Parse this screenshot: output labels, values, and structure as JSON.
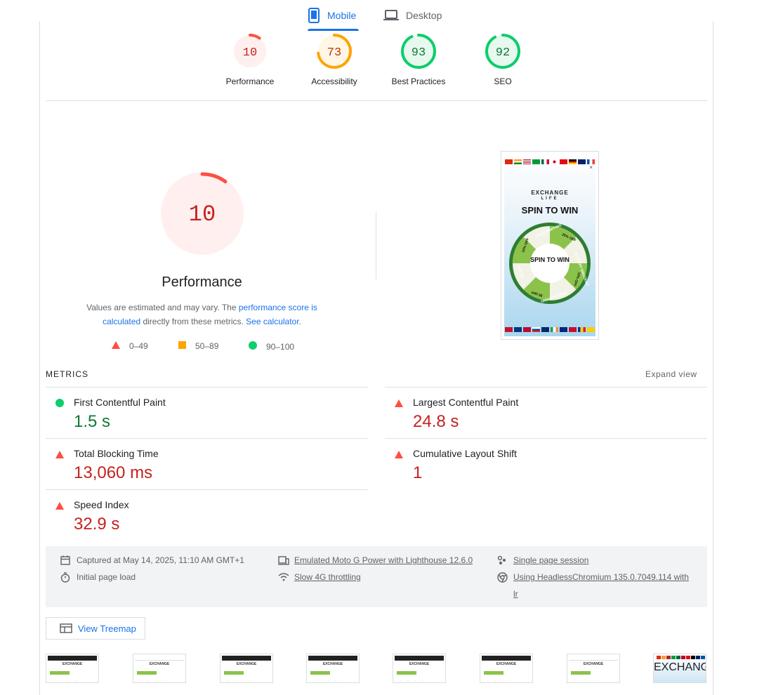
{
  "tabs": {
    "mobile": "Mobile",
    "desktop": "Desktop",
    "active": "mobile"
  },
  "categories": [
    {
      "score": "10",
      "label": "Performance",
      "value": 10,
      "rating": "fail"
    },
    {
      "score": "73",
      "label": "Accessibility",
      "value": 73,
      "rating": "average"
    },
    {
      "score": "93",
      "label": "Best Practices",
      "value": 93,
      "rating": "pass"
    },
    {
      "score": "92",
      "label": "SEO",
      "value": 92,
      "rating": "pass"
    }
  ],
  "performance": {
    "score": "10",
    "value": 10,
    "title": "Performance",
    "desc_prefix": "Values are estimated and may vary. The ",
    "desc_link1": "performance score is calculated",
    "desc_middle": " directly from these metrics. ",
    "desc_link2": "See calculator",
    "desc_suffix": "."
  },
  "legend": {
    "fail": "0–49",
    "average": "50–89",
    "pass": "90–100"
  },
  "screenshot": {
    "brand_line1": "EXCHANGE",
    "brand_line2": "LIFE",
    "headline": "SPIN TO WIN",
    "wheel_center": "SPIN TO WIN",
    "close": "×",
    "segments": [
      "FREE SHIPPING",
      "25% OFF",
      "MYSTERY DISCOUNT",
      "10% OFF",
      "FREE SHIPPING",
      "$5 OFF",
      "5% OFF",
      "10% OFF"
    ]
  },
  "metrics": {
    "title": "METRICS",
    "expand": "Expand view",
    "items": [
      {
        "name": "First Contentful Paint",
        "value": "1.5 s",
        "rating": "pass"
      },
      {
        "name": "Largest Contentful Paint",
        "value": "24.8 s",
        "rating": "fail"
      },
      {
        "name": "Total Blocking Time",
        "value": "13,060 ms",
        "rating": "fail"
      },
      {
        "name": "Cumulative Layout Shift",
        "value": "1",
        "rating": "fail"
      },
      {
        "name": "Speed Index",
        "value": "32.9 s",
        "rating": "fail"
      }
    ]
  },
  "env": {
    "captured": "Captured at May 14, 2025, 11:10 AM GMT+1",
    "load": "Initial page load",
    "device": "Emulated Moto G Power with Lighthouse 12.6.0",
    "throttling": "Slow 4G throttling",
    "session": "Single page session",
    "browser_line1": "Using HeadlessChromium 135.0.7049.114 with",
    "browser_line2": "lr"
  },
  "treemap": {
    "label": "View Treemap"
  },
  "colors": {
    "pass": "#0cce6b",
    "average": "#ffa400",
    "fail": "#ff4e42",
    "link": "#1a73e8"
  }
}
